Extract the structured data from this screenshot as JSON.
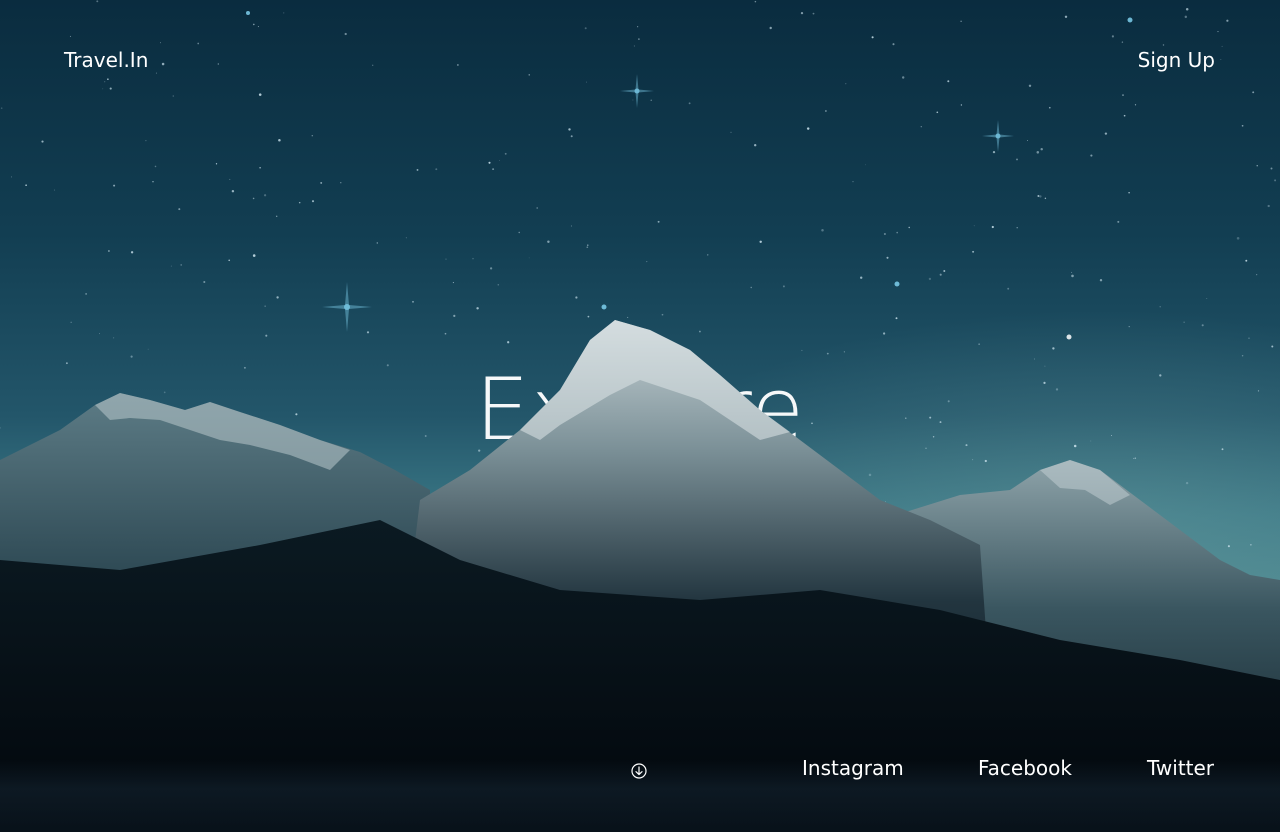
{
  "header": {
    "brand": "Travel.In",
    "signup_label": "Sign Up"
  },
  "hero": {
    "headline": "Explore"
  },
  "footer": {
    "scroll_icon": "arrow-down-circle-icon",
    "social": [
      {
        "label": "Instagram"
      },
      {
        "label": "Facebook"
      },
      {
        "label": "Twitter"
      }
    ]
  },
  "colors": {
    "sky_top": "#0a2c3f",
    "sky_horizon": "#4d8890",
    "ground": "#03080e",
    "text": "#ffffff"
  }
}
